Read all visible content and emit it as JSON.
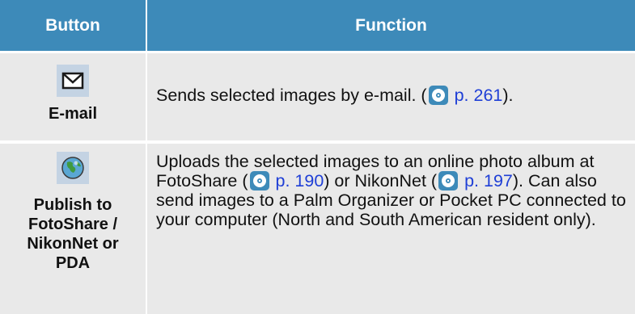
{
  "header": {
    "button_col": "Button",
    "function_col": "Function"
  },
  "rows": [
    {
      "icon": "envelope-icon",
      "label": "E-mail",
      "text_before": "Sends selected images by e-mail. (",
      "ref_icon": "cd-reference-icon",
      "ref": "p. 261",
      "text_after": ")."
    },
    {
      "icon": "globe-icon",
      "label_lines": [
        "Publish to",
        "FotoShare /",
        "NikonNet or",
        "PDA"
      ],
      "text_part1": "Uploads the selected images to an online photo album at FotoShare (",
      "ref1": "p. 190",
      "text_part2": ") or NikonNet (",
      "ref2": "p. 197",
      "text_part3": ").  Can also send images to a Palm Organizer or Pocket PC connected to your computer (North and South American resident only).",
      "ref_icon": "cd-reference-icon"
    }
  ],
  "colors": {
    "header_bg": "#3d8ab9",
    "cell_bg": "#e9e9e9",
    "link": "#1f3fd6"
  }
}
